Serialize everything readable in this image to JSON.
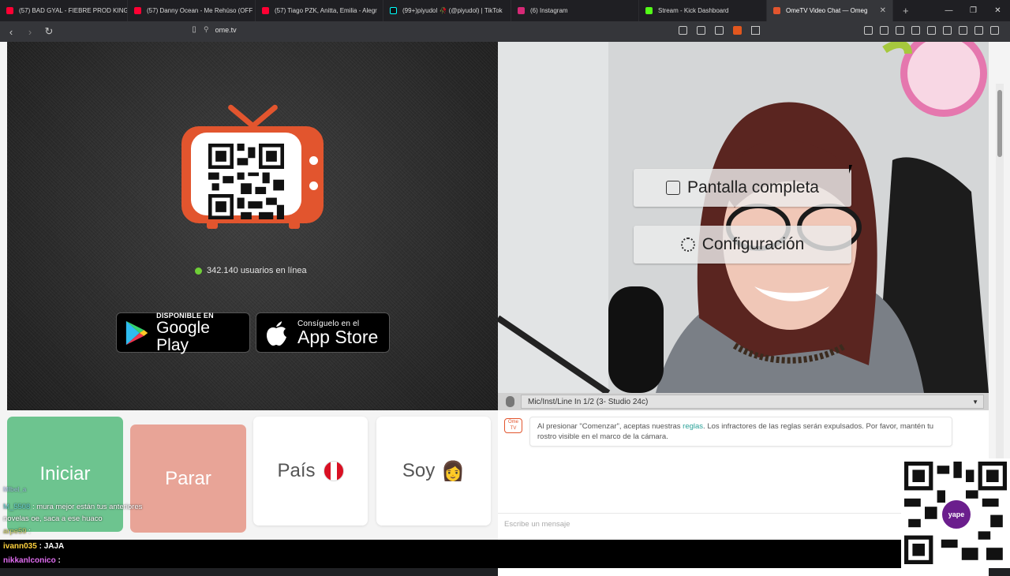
{
  "browser": {
    "tabs": [
      {
        "title": "(57) BAD GYAL - FIEBRE PROD KING",
        "icon": "youtube-icon",
        "color": "#ff0033"
      },
      {
        "title": "(57) Danny Ocean - Me Rehúso (OFF",
        "icon": "youtube-icon",
        "color": "#ff0033"
      },
      {
        "title": "(57) Tiago PZK, Anitta, Emilia - Alegr",
        "icon": "youtube-icon",
        "color": "#ff0033"
      },
      {
        "title": "(99+)piyudol 🥀 (@piyudol) | TikTok",
        "icon": "tiktok-icon",
        "color": "#111111"
      },
      {
        "title": "(6) Instagram",
        "icon": "instagram-icon",
        "color": "#d62976"
      },
      {
        "title": "Stream - Kick Dashboard",
        "icon": "kick-icon",
        "color": "#53fc18"
      },
      {
        "title": "OmeTV Video Chat — Omeg",
        "icon": "ometv-icon",
        "color": "#e2552e"
      }
    ],
    "url": "ome.tv"
  },
  "left_panel": {
    "online_count": "342.140 usuarios en línea",
    "google_play": {
      "small": "DISPONIBLE EN",
      "big": "Google Play"
    },
    "app_store": {
      "small": "Consíguelo en el",
      "big": "App Store"
    }
  },
  "right_panel": {
    "fullscreen_label": "Pantalla completa",
    "settings_label": "Configuración",
    "mic_device": "Mic/Inst/Line In 1/2 (3- Studio 24c)"
  },
  "controls": {
    "start": "Iniciar",
    "stop": "Parar",
    "country": "País",
    "gender": "Soy",
    "gender_emoji": "👩"
  },
  "chat": {
    "logo_text": "Ome TV",
    "rules_prefix": "Al presionar \"Comenzar\", aceptas nuestras ",
    "rules_link": "reglas",
    "rules_suffix": ". Los infractores de las reglas serán expulsados. Por favor, mantén tu rostro visible en el marco de la cámara.",
    "input_placeholder": "Escribe un mensaje"
  },
  "stream_chat": [
    {
      "user": "Mlbel_a",
      "text": ""
    },
    {
      "user": "M_5508",
      "text": ": mura mejor están tus anteriores novelas oe, saca a ese huaco"
    },
    {
      "user": "arpe59",
      "text": ":"
    },
    {
      "user": "ivann035",
      "text": ": JAJA"
    },
    {
      "user": "nikkanlconico",
      "text": ":"
    }
  ],
  "qr_brand": "yape",
  "colors": {
    "accent": "#e2552e",
    "start": "#6dc48f",
    "stop": "#e8a497",
    "online": "#6fcf37"
  }
}
